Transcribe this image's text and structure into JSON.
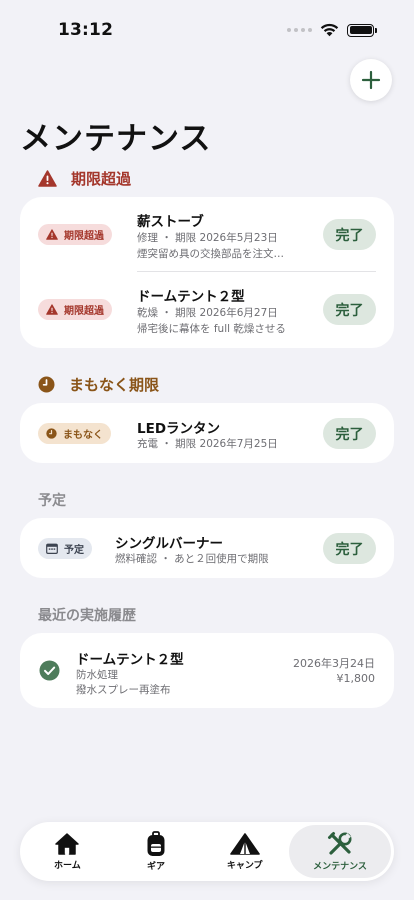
{
  "status_bar": {
    "time": "13:12"
  },
  "page": {
    "title": "メンテナンス"
  },
  "colors": {
    "overdue": "#a4372c",
    "soon": "#8a5519",
    "accent": "#2c5f3d",
    "done_bg": "#dde7df"
  },
  "sections": {
    "overdue": {
      "title": "期限超過",
      "items": [
        {
          "badge": "期限超過",
          "name": "薪ストーブ",
          "line1": "修理 ・ 期限 2026年5月23日",
          "line2": "煙突留め具の交換部品を注文…",
          "action": "完了"
        },
        {
          "badge": "期限超過",
          "name": "ドームテント２型",
          "line1": "乾燥 ・ 期限 2026年6月27日",
          "line2": "帰宅後に幕体を full 乾燥させる",
          "action": "完了"
        }
      ]
    },
    "soon": {
      "title": "まもなく期限",
      "items": [
        {
          "badge": "まもなく",
          "name": "LEDランタン",
          "line1": "充電 ・ 期限 2026年7月25日",
          "action": "完了"
        }
      ]
    },
    "planned": {
      "title": "予定",
      "items": [
        {
          "badge": "予定",
          "name": "シングルバーナー",
          "line1": "燃料確認 ・ あと２回使用で期限",
          "action": "完了"
        }
      ]
    },
    "history": {
      "title": "最近の実施履歴",
      "items": [
        {
          "name": "ドームテント２型",
          "line1": "防水処理",
          "line2": "撥水スプレー再塗布",
          "date": "2026年3月24日",
          "cost": "¥1,800"
        }
      ]
    }
  },
  "tabs": [
    {
      "label": "ホーム",
      "icon": "house-icon"
    },
    {
      "label": "ギア",
      "icon": "backpack-icon"
    },
    {
      "label": "キャンプ",
      "icon": "tent-icon"
    },
    {
      "label": "メンテナンス",
      "icon": "tools-icon",
      "active": true
    }
  ]
}
